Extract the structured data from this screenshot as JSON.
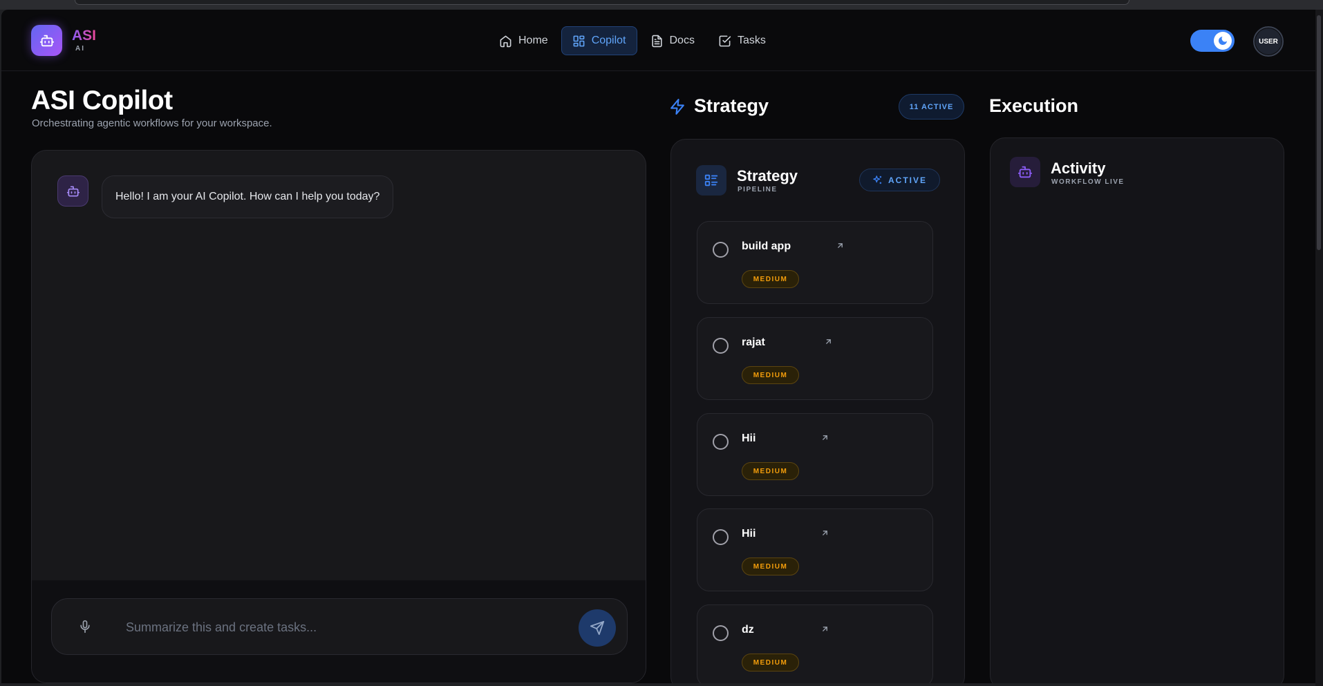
{
  "header": {
    "logo_title": "ASI",
    "logo_sub": "AI",
    "nav": [
      {
        "label": "Home",
        "icon": "home-icon"
      },
      {
        "label": "Copilot",
        "icon": "grid-icon",
        "active": true
      },
      {
        "label": "Docs",
        "icon": "document-icon"
      },
      {
        "label": "Tasks",
        "icon": "checkbox-icon"
      }
    ],
    "theme_toggle": "on",
    "avatar": "USER"
  },
  "copilot": {
    "title": "ASI Copilot",
    "subtitle": "Orchestrating agentic workflows for your workspace.",
    "messages": [
      {
        "from": "bot",
        "text": "Hello! I am your AI Copilot. How can I help you today?"
      }
    ],
    "input_placeholder": "Summarize this and create tasks..."
  },
  "strategy": {
    "heading": "Strategy",
    "count_badge": "11 ACTIVE",
    "card_title": "Strategy",
    "card_sub": "PIPELINE",
    "card_badge": "ACTIVE",
    "tasks": [
      {
        "name": "build app",
        "priority": "MEDIUM"
      },
      {
        "name": "rajat",
        "priority": "MEDIUM"
      },
      {
        "name": "Hii",
        "priority": "MEDIUM"
      },
      {
        "name": "Hii",
        "priority": "MEDIUM"
      },
      {
        "name": "dz",
        "priority": "MEDIUM"
      }
    ]
  },
  "execution": {
    "heading": "Execution",
    "card_title": "Activity",
    "card_sub": "WORKFLOW LIVE"
  },
  "colors": {
    "accent_blue": "#3b82f6",
    "accent_purple": "#8b5cf6",
    "priority_medium": "#f59e0b",
    "background": "#09090b"
  }
}
